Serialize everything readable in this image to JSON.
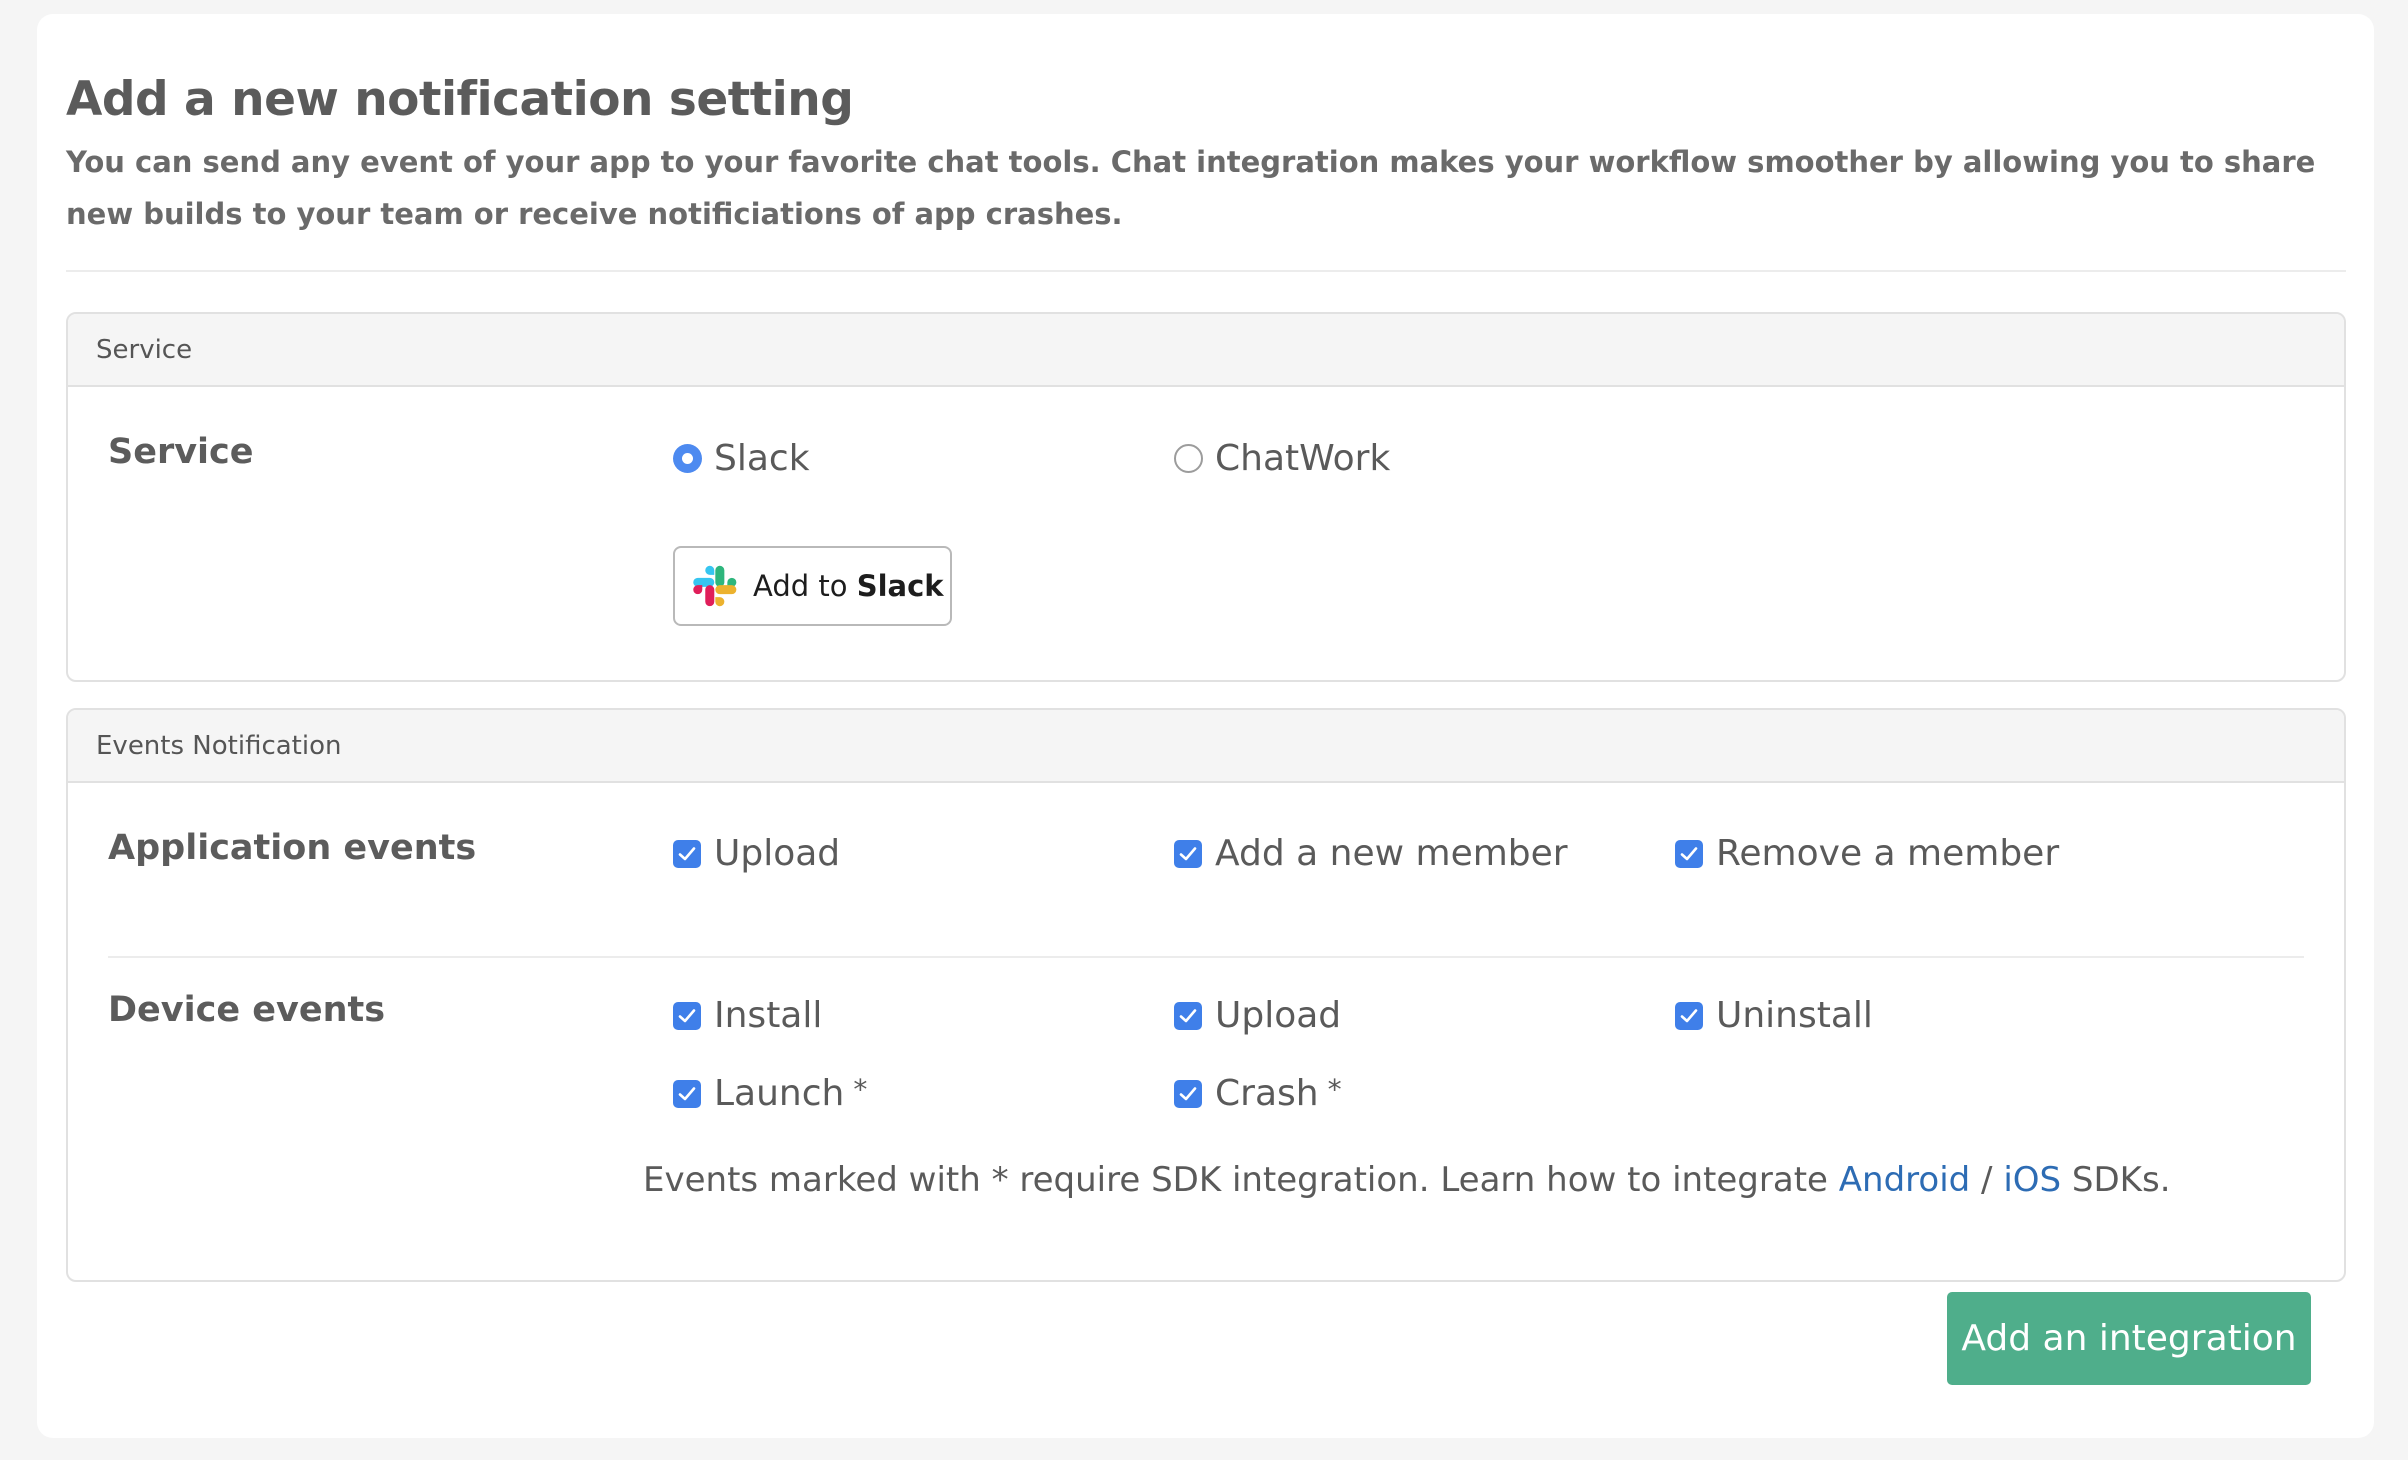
{
  "header": {
    "title": "Add a new notification setting",
    "description": "You can send any event of your app to your favorite chat tools. Chat integration makes your workflow smoother by allowing you to share new builds to your team or receive notificiations of app crashes."
  },
  "service_panel": {
    "heading": "Service",
    "label": "Service",
    "options": [
      {
        "label": "Slack",
        "selected": true
      },
      {
        "label": "ChatWork",
        "selected": false
      }
    ],
    "slack_button": {
      "prefix": "Add to",
      "brand": "Slack"
    }
  },
  "events_panel": {
    "heading": "Events Notification",
    "application_events": {
      "label": "Application events",
      "items": [
        {
          "label": "Upload",
          "checked": true
        },
        {
          "label": "Add a new member",
          "checked": true
        },
        {
          "label": "Remove a member",
          "checked": true
        }
      ]
    },
    "device_events": {
      "label": "Device events",
      "items": [
        {
          "label": "Install",
          "checked": true
        },
        {
          "label": "Upload",
          "checked": true
        },
        {
          "label": "Uninstall",
          "checked": true
        },
        {
          "label": "Launch",
          "checked": true,
          "marker": "*"
        },
        {
          "label": "Crash",
          "checked": true,
          "marker": "*"
        }
      ]
    },
    "note": {
      "prefix": "Events marked with * require SDK integration. Learn how to integrate",
      "android_link": "Android",
      "separator": "/",
      "ios_link": "iOS",
      "suffix": "SDKs."
    }
  },
  "submit_label": "Add an integration",
  "colors": {
    "accent_blue": "#3f7fe9",
    "link_blue": "#2d6cb4",
    "submit_green": "#4fae8b"
  }
}
